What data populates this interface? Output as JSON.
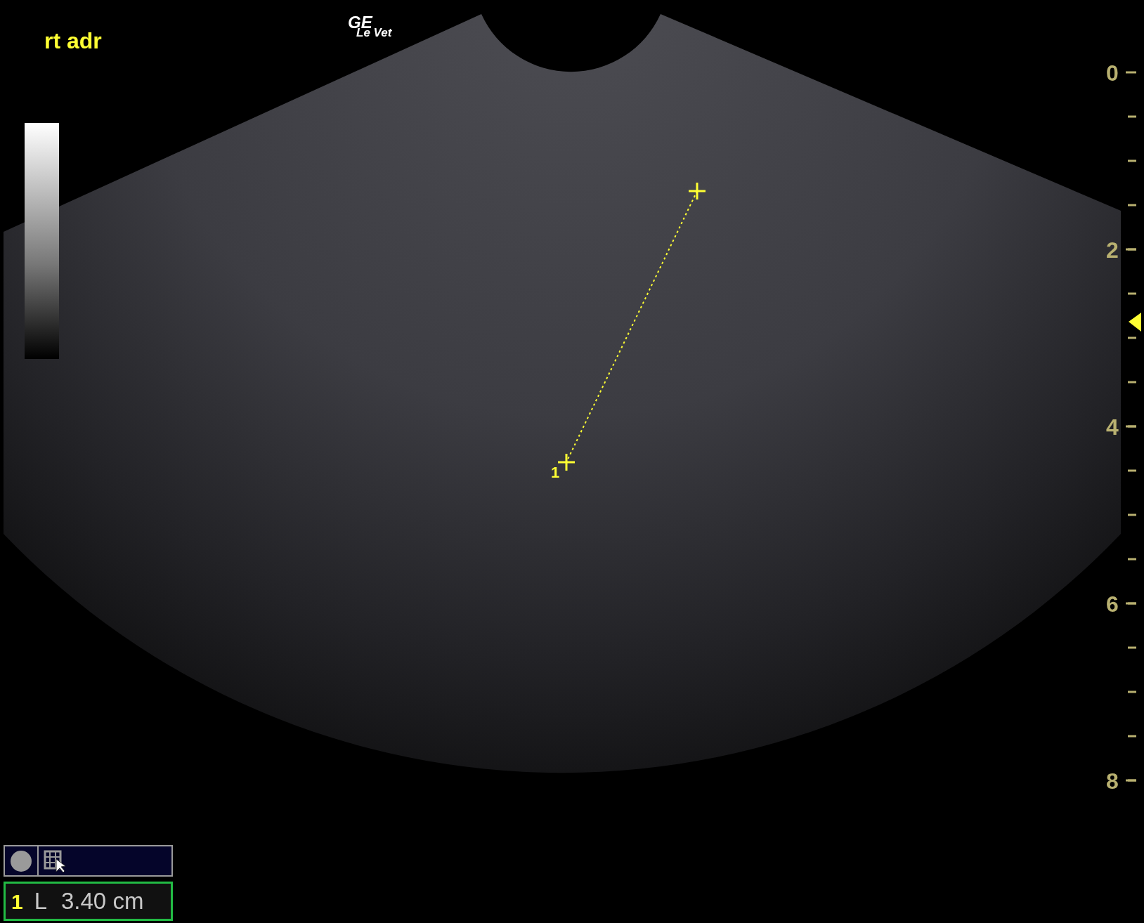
{
  "annotation": "rt adr",
  "logo": {
    "brand": "GE",
    "model": "Le Vet"
  },
  "depth_scale": [
    "0",
    "2",
    "4",
    "6",
    "8"
  ],
  "caliper": {
    "label": "1"
  },
  "measurements": [
    {
      "index": "1",
      "type": "L",
      "value": "3.40 cm"
    }
  ]
}
